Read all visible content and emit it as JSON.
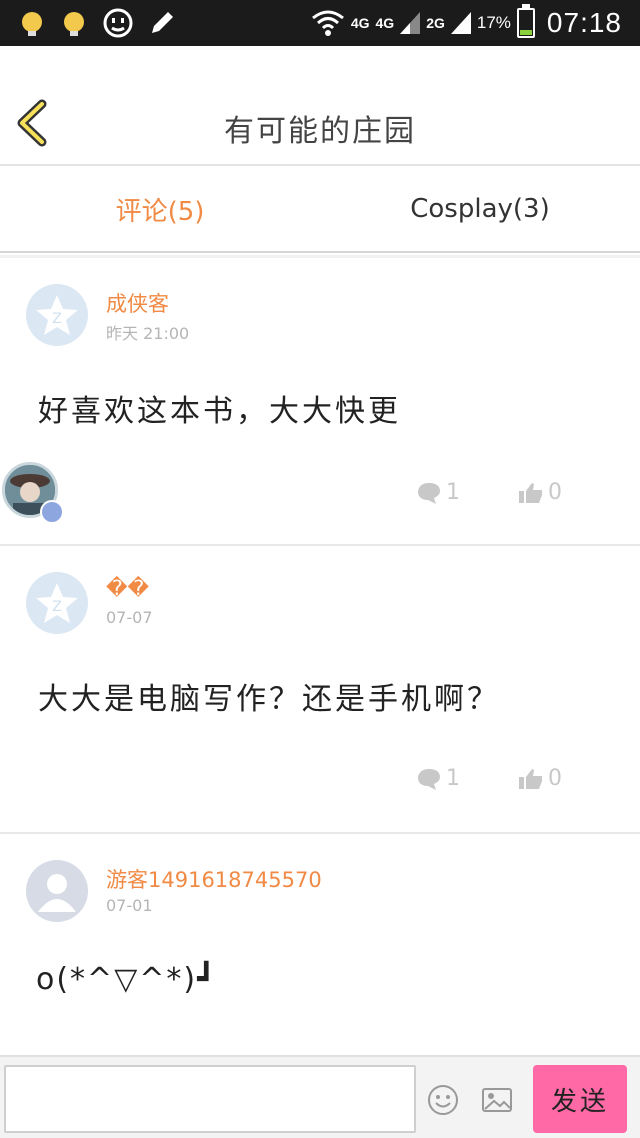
{
  "status_bar": {
    "net1": "4G",
    "net2": "4G",
    "net3": "2G",
    "battery_pct": "17%",
    "time": "07:18"
  },
  "header": {
    "title": "有可能的庄园"
  },
  "tabs": [
    {
      "label": "评论(5)"
    },
    {
      "label": "Cosplay(3)"
    }
  ],
  "comments": [
    {
      "name": "成侠客",
      "time": "昨天 21:00",
      "text": "好喜欢这本书，大大快更",
      "replies": "1",
      "likes": "0"
    },
    {
      "name": "��",
      "time": "07-07",
      "text": "大大是电脑写作？还是手机啊？",
      "replies": "1",
      "likes": "0"
    },
    {
      "name": "游客1491618745570",
      "time": "07-01",
      "text": "o(*^▽^*)┛"
    }
  ],
  "compose": {
    "send_label": "发送"
  },
  "colors": {
    "accent": "#f08a44",
    "send_button": "#ff6aa6",
    "statusbar": "#1b1b1b"
  }
}
